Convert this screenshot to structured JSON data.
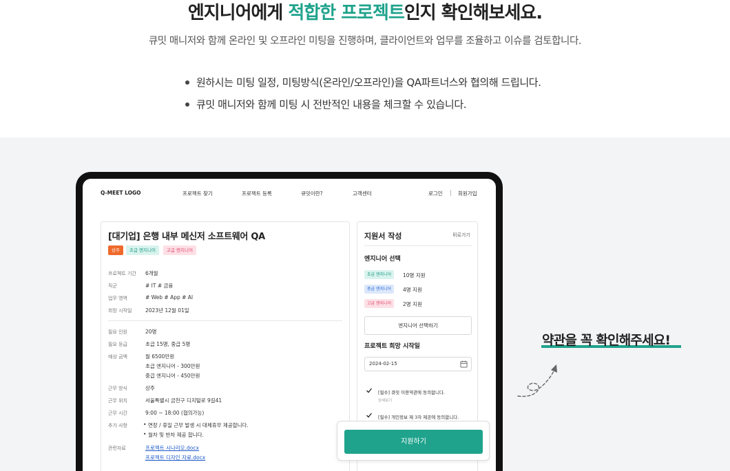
{
  "hero": {
    "title_pre": "엔지니어에게 ",
    "title_highlight": "적합한 프로젝트",
    "title_post": "인지 확인해보세요.",
    "subtitle": "큐밋 매니저와 함께 온라인 및 오프라인 미팅을 진행하며, 클라이언트와 업무를 조율하고 이슈를 검토합니다.",
    "bullets": [
      "원하시는 미팅 일정, 미팅방식(온라인/오프라인)을 QA파트너스와 협의해 드립니다.",
      "큐밋 매니저와 함께 미팅 시 전반적인 내용을 체크할 수 있습니다."
    ],
    "accent_color": "#1fa38c"
  },
  "nav": {
    "logo": "Q-MEET LOGO",
    "items": [
      "프로젝트 찾기",
      "프로젝트 등록",
      "큐밋이란?",
      "고객센터"
    ],
    "login": "로그인",
    "signup": "회원가입"
  },
  "project": {
    "title": "[대기업] 은행 내부 메신저 소프트웨어 QA",
    "tags": [
      "상주",
      "초급 엔지니어",
      "고급 엔지니어"
    ],
    "rows": [
      {
        "label": "프로젝트 기간",
        "value": "6개월"
      },
      {
        "label": "직군",
        "value": "# IT   # 금융"
      },
      {
        "label": "업무 영역",
        "value": "# Web   # App # AI"
      },
      {
        "label": "희망 시작일",
        "value": "2023년 12월 01일"
      },
      {
        "label": "필요 인원",
        "value": "20명"
      },
      {
        "label": "필요 등급",
        "value": "초급 15명, 중급 5명"
      },
      {
        "label": "예상 금액",
        "value": "월 6500만원"
      },
      {
        "label": "근무 방식",
        "value": "상주"
      },
      {
        "label": "근무 위치",
        "value": "서울특별시 금천구 디지털로 9길41"
      },
      {
        "label": "근무 시간",
        "value": "9:00 ~ 18:00 (협의가능)"
      },
      {
        "label": "추가 사항",
        "value": ""
      },
      {
        "label": "관련자료",
        "value": ""
      }
    ],
    "amount_details": [
      "초급 엔지니어 - 300만원",
      "중급 엔지니어 - 450만원"
    ],
    "extra_bullets": [
      "연장 / 휴일 근무 발생 시 대체휴무 제공합니다.",
      "월차 및 반차 제공 합니다."
    ],
    "files": [
      "프로젝트 시나리오.docx",
      "프로젝트 디자인 자료.docx"
    ]
  },
  "apply": {
    "title": "지원서 작성",
    "back": "뒤로가기",
    "engineer_section": "엔지니어 선택",
    "levels": [
      {
        "tag": "초급 엔지니어",
        "count": "10명 지원"
      },
      {
        "tag": "중급 엔지니어",
        "count": "4명 지원"
      },
      {
        "tag": "고급 엔지니어",
        "count": "2명 지원"
      }
    ],
    "select_button": "엔지니어 선택하기",
    "date_section": "프로젝트 희망 시작일",
    "date_value": "2024-02-15",
    "agreements": [
      {
        "label": "[필수] 큐밋 이용약관에 동의합니다.",
        "checked": true
      },
      {
        "label": "[필수] 개인정보 제 3자 제공에 동의합니다.",
        "checked": true
      }
    ],
    "detail_link": "상세보기",
    "submit": "지원하기"
  },
  "callout": {
    "text": "약관을 꼭 확인해주세요!"
  }
}
